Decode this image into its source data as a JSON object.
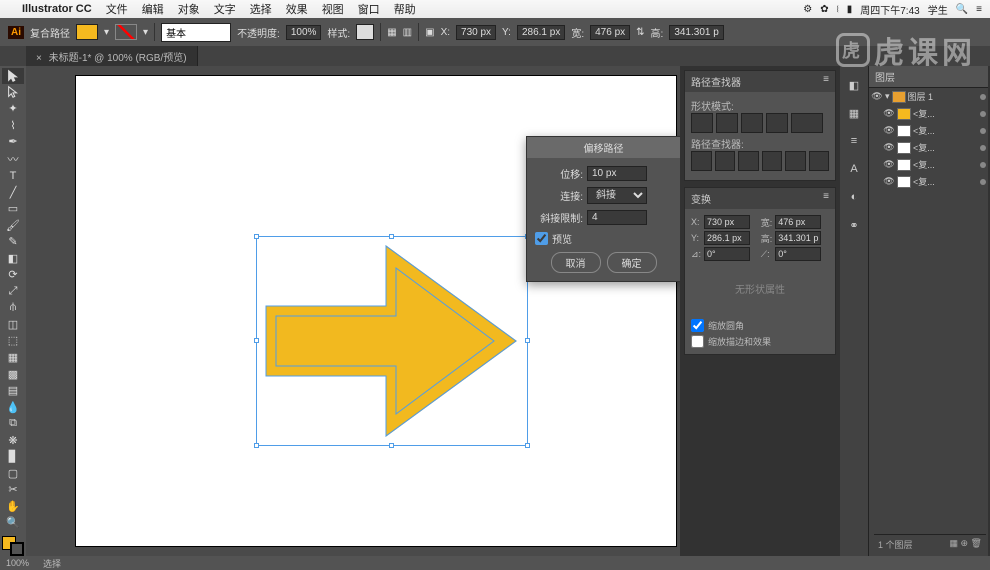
{
  "mac_menu": {
    "app": "Illustrator CC",
    "items": [
      "文件",
      "编辑",
      "对象",
      "文字",
      "选择",
      "效果",
      "视图",
      "窗口",
      "帮助"
    ],
    "clock": "周四下午7:43",
    "user": "学生"
  },
  "control": {
    "label": "复合路径",
    "fill_color": "#f5b91f",
    "stroke_preset": "基本",
    "opacity_label": "不透明度:",
    "opacity": "100%",
    "style_label": "样式:",
    "x_label": "X:",
    "x": "730 px",
    "y_label": "Y:",
    "y": "286.1 px",
    "w_label": "宽:",
    "w": "476 px",
    "h_label": "高:",
    "h": "341.301 p"
  },
  "tab": {
    "name": "未标题-1* @ 100% (RGB/预览)"
  },
  "dialog": {
    "title": "偏移路径",
    "offset_label": "位移:",
    "offset": "10 px",
    "join_label": "连接:",
    "join": "斜接",
    "miter_label": "斜接限制:",
    "miter": "4",
    "preview": "预览",
    "cancel": "取消",
    "ok": "确定"
  },
  "pathfinder": {
    "title": "路径查找器",
    "mode_label": "形状模式:",
    "pf_label": "路径查找器:"
  },
  "transform": {
    "title": "变换",
    "x_label": "X:",
    "x": "730 px",
    "y_label": "Y:",
    "y": "286.1 px",
    "w_label": "宽:",
    "w": "476 px",
    "h_label": "高:",
    "h": "341.301 p",
    "angle_label": "⊿:",
    "angle": "0°",
    "shear_label": "⟋:",
    "shear": "0°",
    "noshape": "无形状属性",
    "scale_corners": "缩放圆角",
    "scale_strokes": "缩放描边和效果"
  },
  "layers": {
    "title": "图层",
    "top": "图层 1",
    "items": [
      "<复...",
      "<复...",
      "<复...",
      "<复...",
      "<复..."
    ],
    "footer_count": "1 个图层"
  },
  "status": {
    "zoom": "100%",
    "tool": "选择"
  },
  "watermark": "虎课网"
}
